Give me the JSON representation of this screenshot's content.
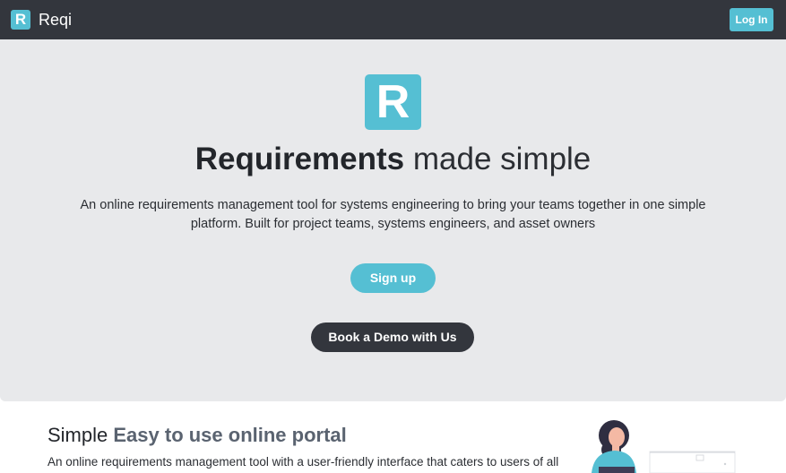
{
  "navbar": {
    "brand_letter": "R",
    "brand_name": "Reqi",
    "login_label": "Log In"
  },
  "hero": {
    "logo_letter": "R",
    "title_strong": "Requirements",
    "title_light": "made simple",
    "description": "An online requirements management tool for systems engineering to bring your teams together in one simple platform. Built for project teams, systems engineers, and asset owners",
    "signup_label": "Sign up",
    "demo_label": "Book a Demo with Us"
  },
  "feature": {
    "title_strong": "Simple",
    "title_accent": "Easy to use online portal",
    "description": "An online requirements management tool with a user-friendly interface that caters to users of all"
  },
  "colors": {
    "brand": "#55bfd3",
    "dark": "#33363d",
    "hero_bg": "#e8e9eb"
  },
  "illustration": {
    "icon": "person-with-laptop-illustration"
  }
}
